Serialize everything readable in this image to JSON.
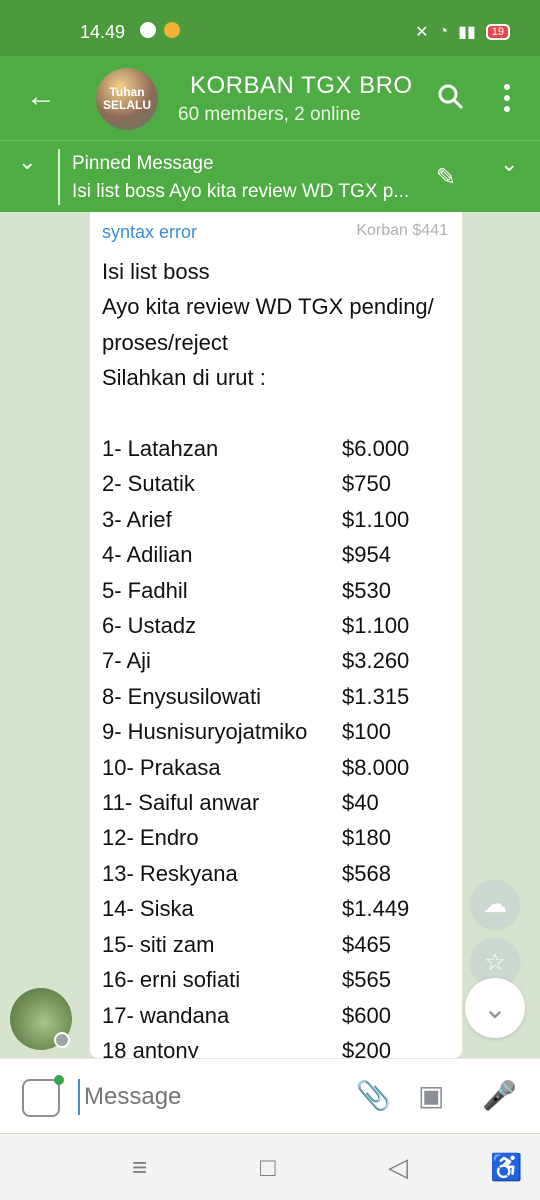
{
  "status": {
    "time": "14.49",
    "battery": "19"
  },
  "header": {
    "title": "KORBAN TGX BRO",
    "subtitle": "60 members, 2 online",
    "avatar_text_top": "Tuhan",
    "avatar_text_bottom": "SELALU"
  },
  "pinned": {
    "title": "Pinned Message",
    "text": "Isi list boss Ayo kita review WD TGX p..."
  },
  "message": {
    "sender": "syntax error",
    "admin_tag": "Korban $441",
    "lines": [
      "Isi list boss",
      "Ayo kita review WD TGX pending/",
      "proses/reject",
      "Silahkan di urut :"
    ],
    "items": [
      {
        "name": "1- Latahzan",
        "amount": "$6.000"
      },
      {
        "name": "2- Sutatik",
        "amount": "$750"
      },
      {
        "name": "3- Arief",
        "amount": "$1.100"
      },
      {
        "name": "4- Adilian",
        "amount": "$954"
      },
      {
        "name": "5- Fadhil",
        "amount": "$530"
      },
      {
        "name": "6- Ustadz",
        "amount": "$1.100"
      },
      {
        "name": "7- Aji",
        "amount": "$3.260"
      },
      {
        "name": "8- Enysusilowati",
        "amount": "$1.315"
      },
      {
        "name": "9- Husnisuryojatmiko",
        "amount": "$100"
      },
      {
        "name": "10- Prakasa",
        "amount": "$8.000"
      },
      {
        "name": "11- Saiful anwar",
        "amount": "$40"
      },
      {
        "name": "12- Endro",
        "amount": "$180"
      },
      {
        "name": "13- Reskyana",
        "amount": "$568"
      },
      {
        "name": "14- Siska",
        "amount": "$1.449"
      },
      {
        "name": "15- siti zam",
        "amount": "$465"
      },
      {
        "name": "16- erni sofiati",
        "amount": "$565"
      },
      {
        "name": "17- wandana",
        "amount": "$600"
      },
      {
        "name": "18 antony",
        "amount": "$200"
      }
    ]
  },
  "input": {
    "placeholder": "Message"
  }
}
